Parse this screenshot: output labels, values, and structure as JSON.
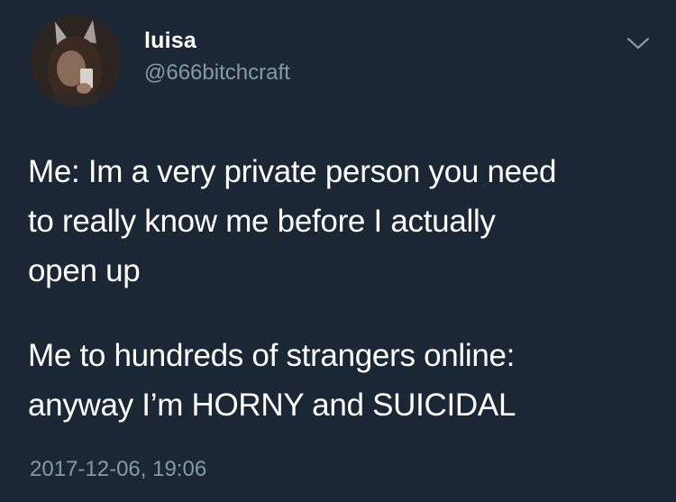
{
  "tweet": {
    "author": {
      "display_name": "luisa",
      "handle": "@666bitchcraft"
    },
    "paragraphs": [
      "Me: Im a very private person you need\nto really know me before I actually\nopen up",
      "Me to hundreds of strangers online:\nanyway I’m HORNY and SUICIDAL"
    ],
    "timestamp": "2017-12-06, 19:06",
    "icons": {
      "menu": "chevron-down-icon"
    }
  },
  "colors": {
    "background": "#1b2735",
    "primary_text": "#ffffff",
    "secondary_text": "#8899a6"
  }
}
